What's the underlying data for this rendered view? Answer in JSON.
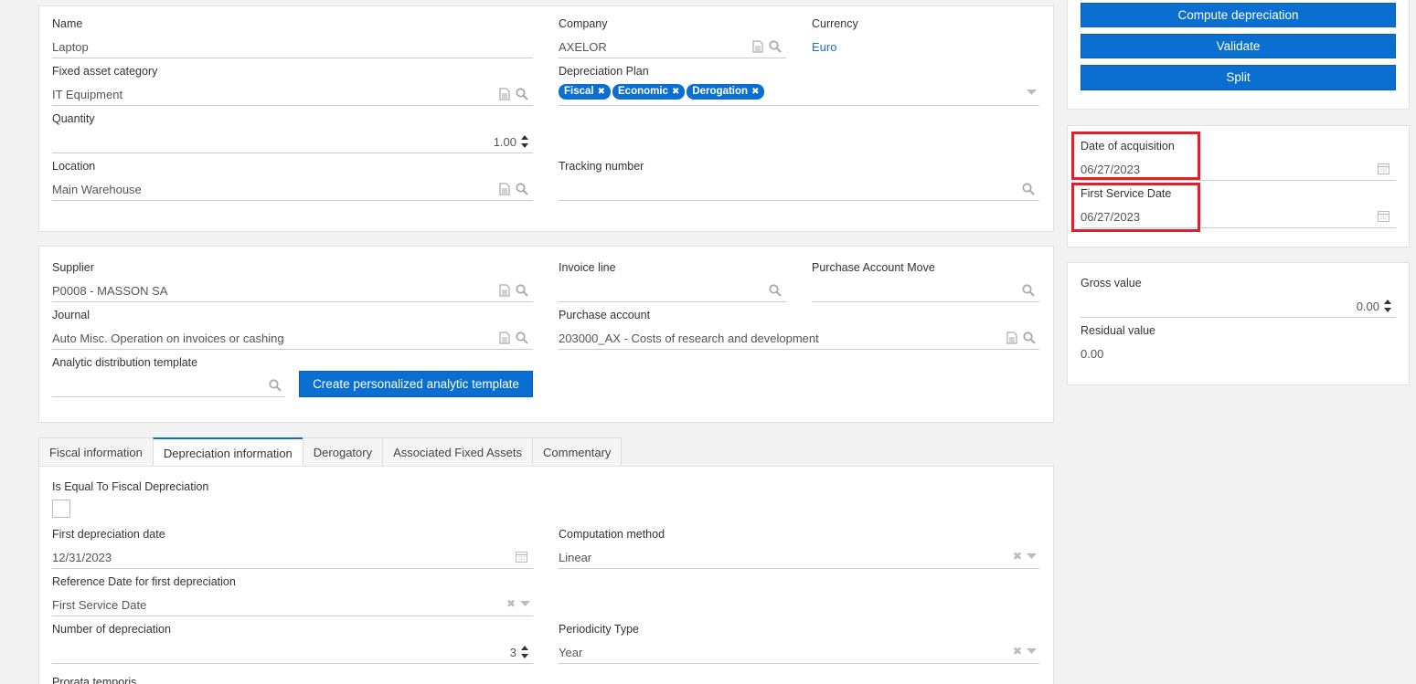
{
  "general": {
    "name_label": "Name",
    "name_value": "Laptop",
    "company_label": "Company",
    "company_value": "AXELOR",
    "currency_label": "Currency",
    "currency_value": "Euro",
    "category_label": "Fixed asset category",
    "category_value": "IT Equipment",
    "plan_label": "Depreciation Plan",
    "plan_tags": [
      "Fiscal",
      "Economic",
      "Derogation"
    ],
    "quantity_label": "Quantity",
    "quantity_value": "1.00",
    "location_label": "Location",
    "location_value": "Main Warehouse",
    "tracking_label": "Tracking number",
    "tracking_value": ""
  },
  "purchase": {
    "supplier_label": "Supplier",
    "supplier_value": "P0008 - MASSON SA",
    "invoice_line_label": "Invoice line",
    "purchase_move_label": "Purchase Account Move",
    "journal_label": "Journal",
    "journal_value": "Auto Misc. Operation on invoices or cashing",
    "purchase_account_label": "Purchase account",
    "purchase_account_value": "203000_AX - Costs of research and development",
    "analytic_label": "Analytic distribution template",
    "create_template_button": "Create personalized analytic template"
  },
  "actions": {
    "compute_button": "Compute depreciation",
    "validate_button": "Validate",
    "split_button": "Split"
  },
  "dates": {
    "acquisition_label": "Date of acquisition",
    "acquisition_value": "06/27/2023",
    "service_label": "First Service Date",
    "service_value": "06/27/2023"
  },
  "values": {
    "gross_label": "Gross value",
    "gross_value": "0.00",
    "residual_label": "Residual value",
    "residual_value": "0.00"
  },
  "tabs": [
    "Fiscal information",
    "Depreciation information",
    "Derogatory",
    "Associated Fixed Assets",
    "Commentary"
  ],
  "active_tab": "Depreciation information",
  "depreciation": {
    "equal_fiscal_label": "Is Equal To Fiscal Depreciation",
    "equal_fiscal_checked": false,
    "first_date_label": "First depreciation date",
    "first_date_value": "12/31/2023",
    "computation_label": "Computation method",
    "computation_value": "Linear",
    "reference_label": "Reference Date for first depreciation",
    "reference_value": "First Service Date",
    "number_label": "Number of depreciation",
    "number_value": "3",
    "periodicity_label": "Periodicity Type",
    "periodicity_value": "Year",
    "prorata_label": "Prorata temporis"
  },
  "colors": {
    "accent": "#0a6fd1",
    "highlight": "#e2202b",
    "background": "#f2f2f2"
  }
}
